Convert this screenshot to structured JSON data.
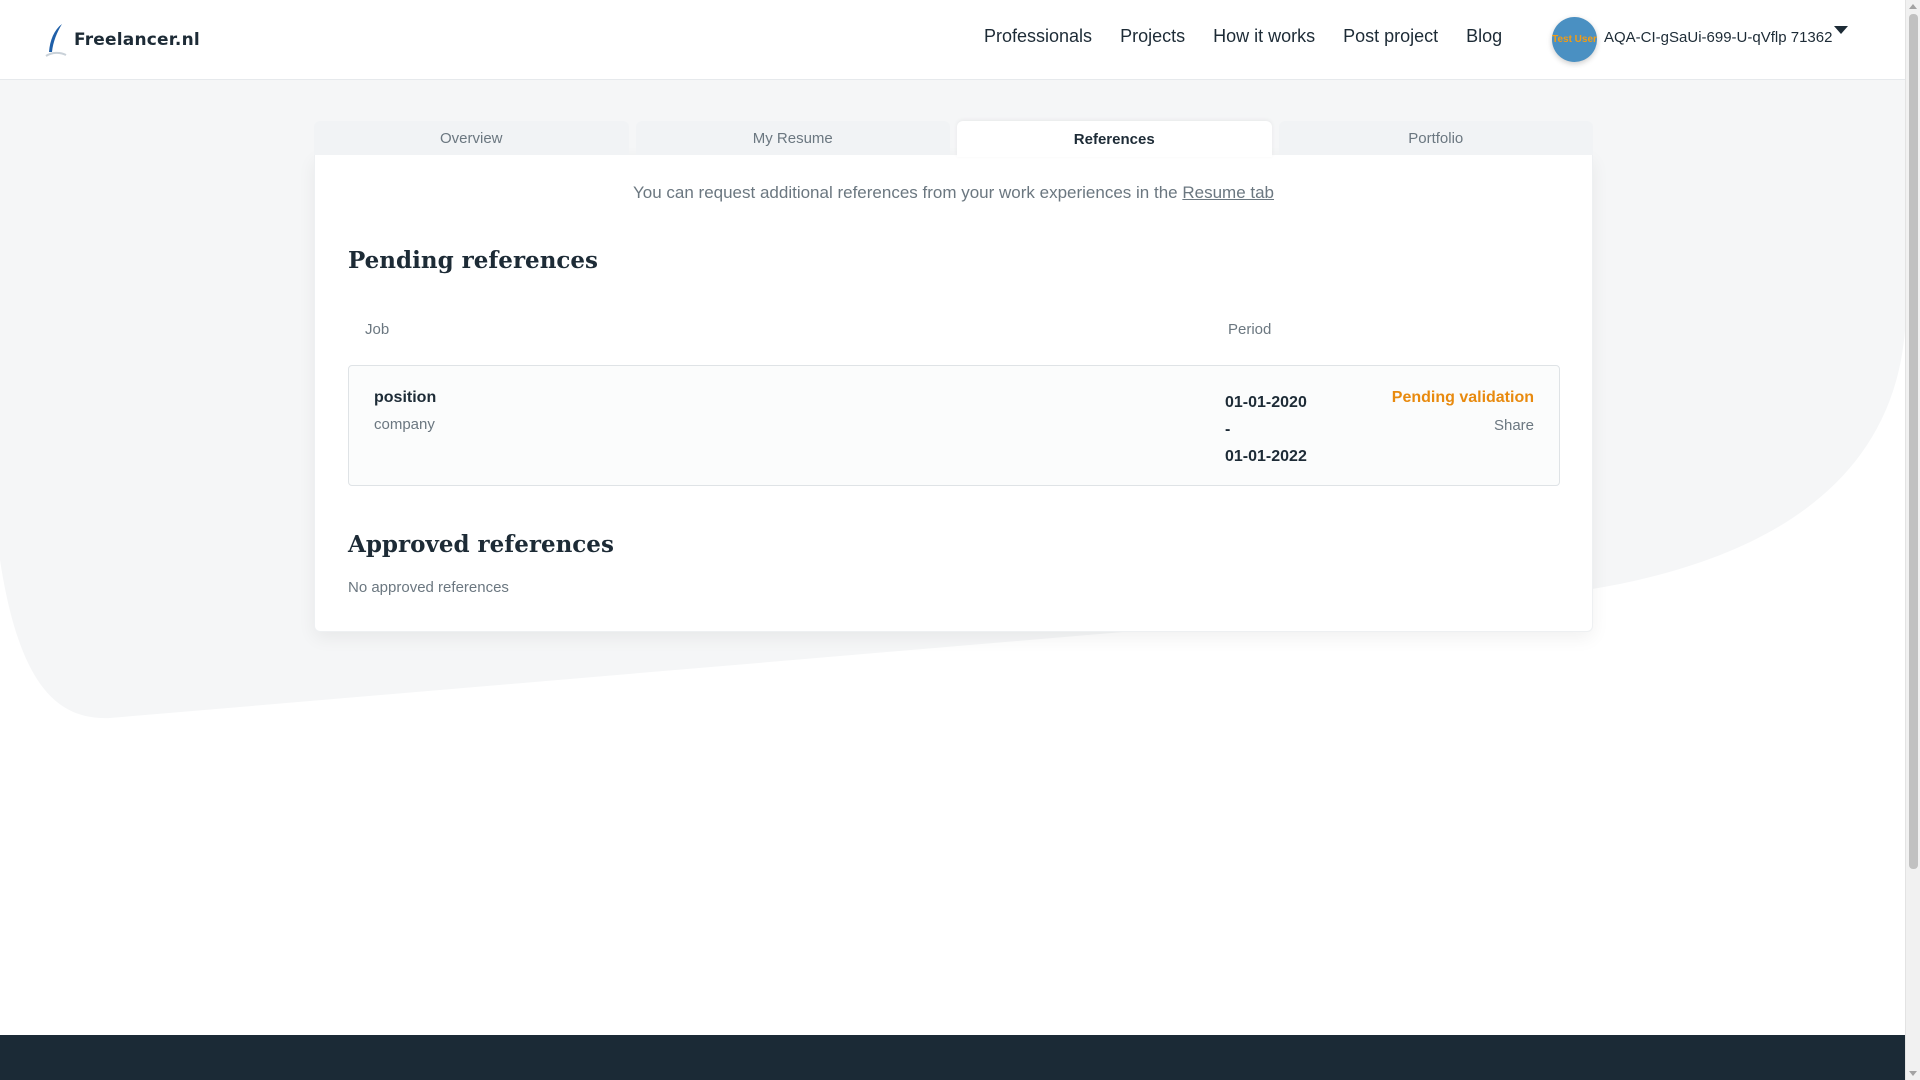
{
  "header": {
    "logo_text": "Freelancer.nl",
    "nav": [
      "Professionals",
      "Projects",
      "How it works",
      "Post project",
      "Blog"
    ],
    "avatar_text": "Test User",
    "username": "AQA-CI-gSaUi-699-U-qVflp 71362"
  },
  "tabs": [
    {
      "label": "Overview",
      "active": false
    },
    {
      "label": "My Resume",
      "active": false
    },
    {
      "label": "References",
      "active": true
    },
    {
      "label": "Portfolio",
      "active": false
    }
  ],
  "info": {
    "text": "You can request additional references from your work experiences in the ",
    "link": "Resume tab"
  },
  "pending": {
    "title": "Pending references",
    "columns": {
      "job": "Job",
      "period": "Period"
    },
    "rows": [
      {
        "position": "position",
        "company": "company",
        "period_start": "01-01-2020",
        "period_sep": "-",
        "period_end": "01-01-2022",
        "status": "Pending validation",
        "action": "Share"
      }
    ]
  },
  "approved": {
    "title": "Approved references",
    "empty": "No approved references"
  },
  "colors": {
    "accent_orange": "#e88a0e",
    "footer_bg": "#1b2a36",
    "avatar_bg": "#4a90c2"
  }
}
